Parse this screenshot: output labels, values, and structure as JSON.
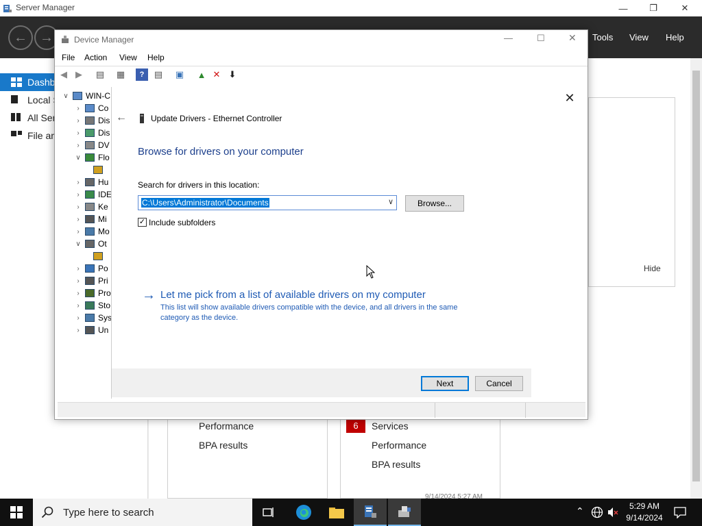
{
  "server_manager": {
    "title": "Server Manager",
    "menu": [
      "Tools",
      "View",
      "Help"
    ],
    "sidebar": [
      {
        "label": "Dashb",
        "selected": true
      },
      {
        "label": "Local S",
        "selected": false
      },
      {
        "label": "All Ser",
        "selected": false
      },
      {
        "label": "File an",
        "selected": false
      }
    ],
    "hide_label": "Hide",
    "tile_left": {
      "links": [
        "Performance",
        "BPA results"
      ]
    },
    "tile_right": {
      "badge": "6",
      "links": [
        "Services",
        "Performance",
        "BPA results"
      ]
    },
    "timestamp": "9/14/2024 5:27 AM"
  },
  "device_manager": {
    "title": "Device Manager",
    "menu": [
      "File",
      "Action",
      "View",
      "Help"
    ],
    "root": "WIN-C",
    "tree": [
      {
        "label": "Co",
        "expanded": false,
        "child": false
      },
      {
        "label": "Dis",
        "expanded": false,
        "child": false
      },
      {
        "label": "Dis",
        "expanded": false,
        "child": false
      },
      {
        "label": "DV",
        "expanded": false,
        "child": false
      },
      {
        "label": "Flo",
        "expanded": true,
        "child": false
      },
      {
        "label": "",
        "expanded": false,
        "child": true
      },
      {
        "label": "Hu",
        "expanded": false,
        "child": false
      },
      {
        "label": "IDE",
        "expanded": false,
        "child": false
      },
      {
        "label": "Ke",
        "expanded": false,
        "child": false
      },
      {
        "label": "Mi",
        "expanded": false,
        "child": false
      },
      {
        "label": "Mo",
        "expanded": false,
        "child": false
      },
      {
        "label": "Ot",
        "expanded": true,
        "child": false
      },
      {
        "label": "",
        "expanded": false,
        "child": true
      },
      {
        "label": "Po",
        "expanded": false,
        "child": false
      },
      {
        "label": "Pri",
        "expanded": false,
        "child": false
      },
      {
        "label": "Pro",
        "expanded": false,
        "child": false
      },
      {
        "label": "Sto",
        "expanded": false,
        "child": false
      },
      {
        "label": "Sys",
        "expanded": false,
        "child": false
      },
      {
        "label": "Un",
        "expanded": false,
        "child": false
      }
    ]
  },
  "dialog": {
    "title": "Update Drivers - Ethernet Controller",
    "heading": "Browse for drivers on your computer",
    "search_label": "Search for drivers in this location:",
    "path_value": "C:\\Users\\Administrator\\Documents",
    "browse_label": "Browse...",
    "include_subfolders_label": "Include subfolders",
    "include_subfolders_checked": true,
    "pick_link": "Let me pick from a list of available drivers on my computer",
    "pick_desc": "This list will show available drivers compatible with the device, and all drivers in the same category as the device.",
    "next_label": "Next",
    "cancel_label": "Cancel"
  },
  "taskbar": {
    "search_placeholder": "Type here to search",
    "time": "5:29 AM",
    "date": "9/14/2024"
  },
  "colors": {
    "accent": "#1979ca",
    "link": "#1e5ab4",
    "badge": "#c00000",
    "heading": "#1c3f8c"
  }
}
